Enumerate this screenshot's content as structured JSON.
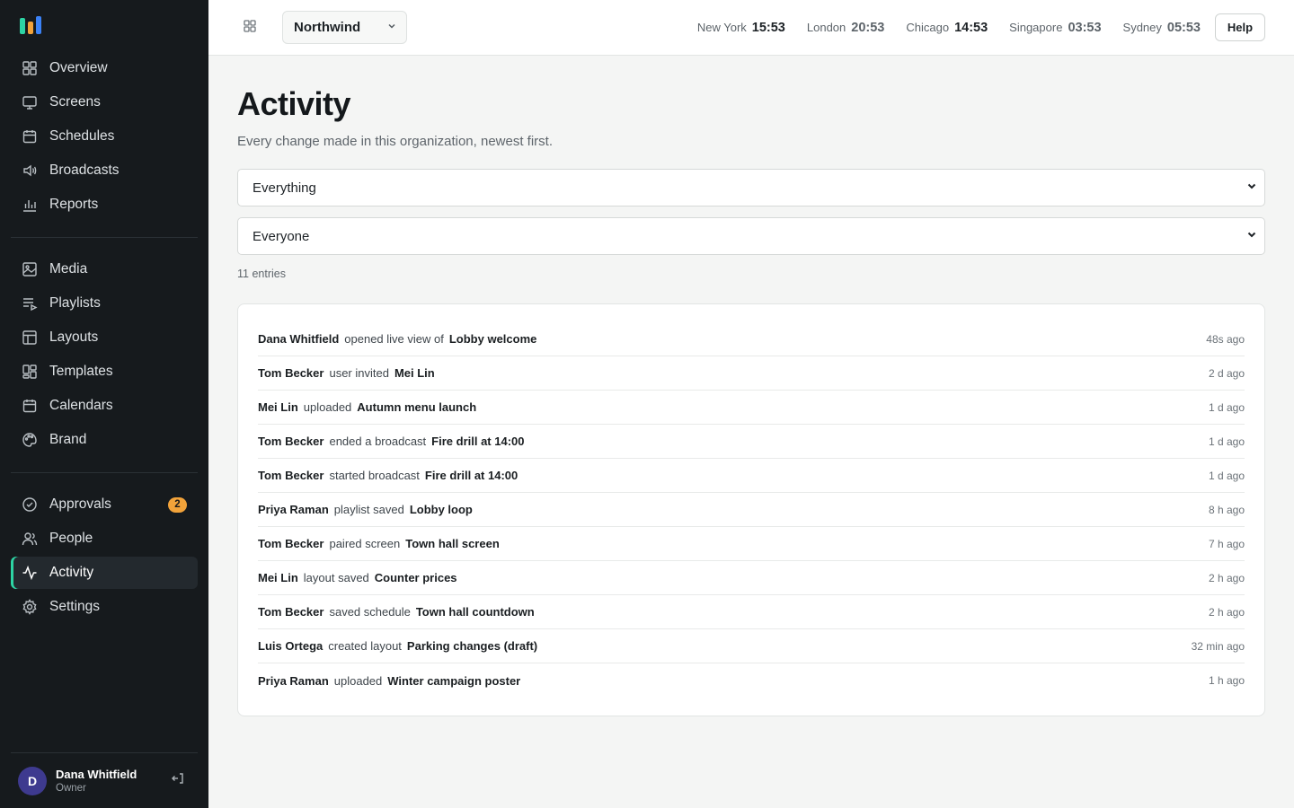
{
  "brand": {
    "logo_colors": [
      "#2dd4a4",
      "#f2a33a",
      "#3b82f6"
    ]
  },
  "sidebar": {
    "groups": [
      [
        {
          "label": "Overview",
          "icon": "overview-icon"
        },
        {
          "label": "Screens",
          "icon": "screens-icon"
        },
        {
          "label": "Schedules",
          "icon": "schedules-icon"
        },
        {
          "label": "Broadcasts",
          "icon": "broadcasts-icon"
        },
        {
          "label": "Reports",
          "icon": "reports-icon"
        }
      ],
      [
        {
          "label": "Media",
          "icon": "media-icon"
        },
        {
          "label": "Playlists",
          "icon": "playlists-icon"
        },
        {
          "label": "Layouts",
          "icon": "layouts-icon"
        },
        {
          "label": "Templates",
          "icon": "templates-icon"
        },
        {
          "label": "Calendars",
          "icon": "calendars-icon"
        },
        {
          "label": "Brand",
          "icon": "brand-icon"
        }
      ],
      [
        {
          "label": "Approvals",
          "icon": "approvals-icon",
          "badge": "2"
        },
        {
          "label": "People",
          "icon": "people-icon"
        },
        {
          "label": "Activity",
          "icon": "activity-icon",
          "active": true
        },
        {
          "label": "Settings",
          "icon": "settings-icon"
        }
      ]
    ],
    "user": {
      "initial": "D",
      "name": "Dana Whitfield",
      "role": "Owner"
    }
  },
  "topbar": {
    "org": "Northwind",
    "clocks": [
      {
        "city": "New York",
        "time": "15:53",
        "dim": false
      },
      {
        "city": "London",
        "time": "20:53",
        "dim": true
      },
      {
        "city": "Chicago",
        "time": "14:53",
        "dim": false
      },
      {
        "city": "Singapore",
        "time": "03:53",
        "dim": true
      },
      {
        "city": "Sydney",
        "time": "05:53",
        "dim": true
      }
    ],
    "help_label": "Help"
  },
  "main": {
    "title": "Activity",
    "subtitle": "Every change made in this organization, newest first.",
    "filter_type": "Everything",
    "filter_people": "Everyone",
    "count": "11 entries",
    "entries": [
      {
        "actor": "Dana Whitfield",
        "verb": "opened live view of",
        "target": "Lobby welcome",
        "when": "48s ago"
      },
      {
        "actor": "Tom Becker",
        "verb": "user invited",
        "target": "Mei Lin",
        "when": "2 d ago"
      },
      {
        "actor": "Mei Lin",
        "verb": "uploaded",
        "target": "Autumn menu launch",
        "when": "1 d ago"
      },
      {
        "actor": "Tom Becker",
        "verb": "ended a broadcast",
        "target": "Fire drill at 14:00",
        "when": "1 d ago"
      },
      {
        "actor": "Tom Becker",
        "verb": "started broadcast",
        "target": "Fire drill at 14:00",
        "when": "1 d ago"
      },
      {
        "actor": "Priya Raman",
        "verb": "playlist saved",
        "target": "Lobby loop",
        "when": "8 h ago"
      },
      {
        "actor": "Tom Becker",
        "verb": "paired screen",
        "target": "Town hall screen",
        "when": "7 h ago"
      },
      {
        "actor": "Mei Lin",
        "verb": "layout saved",
        "target": "Counter prices",
        "when": "2 h ago"
      },
      {
        "actor": "Tom Becker",
        "verb": "saved schedule",
        "target": "Town hall countdown",
        "when": "2 h ago"
      },
      {
        "actor": "Luis Ortega",
        "verb": "created layout",
        "target": "Parking changes (draft)",
        "when": "32 min ago"
      },
      {
        "actor": "Priya Raman",
        "verb": "uploaded",
        "target": "Winter campaign poster",
        "when": "1 h ago"
      }
    ]
  }
}
